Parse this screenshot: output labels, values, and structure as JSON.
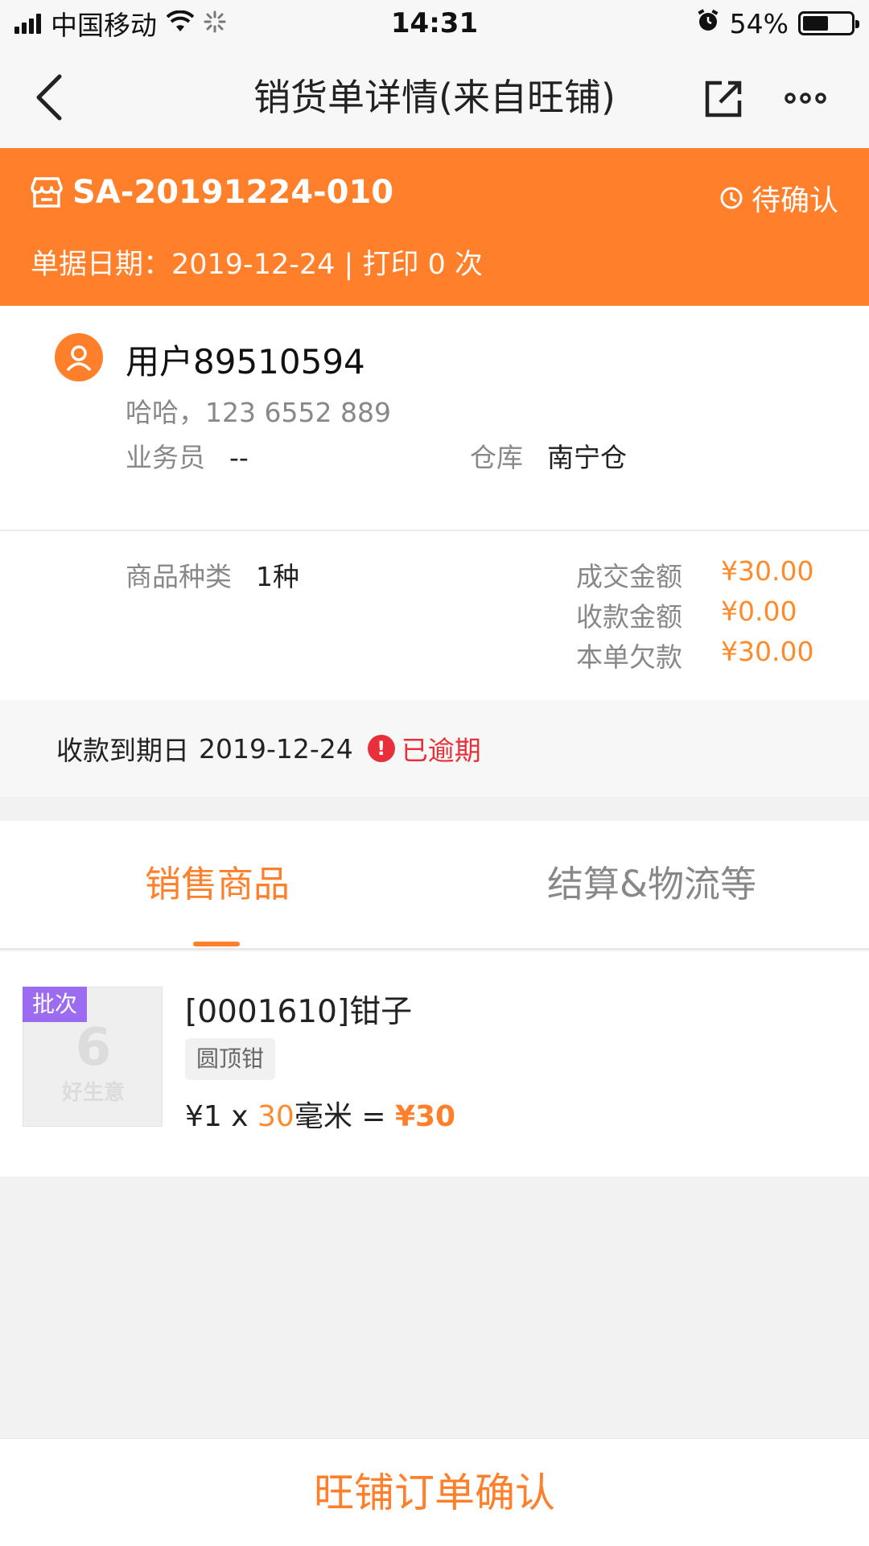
{
  "status_bar": {
    "carrier": "中国移动",
    "time": "14:31",
    "battery": "54%",
    "battery_level": 0.54
  },
  "nav": {
    "title": "销货单详情(来自旺铺)"
  },
  "order": {
    "number": "SA-20191224-010",
    "status": "待确认",
    "meta": "单据日期：2019-12-24 | 打印 0 次"
  },
  "customer": {
    "name": "用户89510594",
    "contact": "哈哈，123 6552 889",
    "salesperson_label": "业务员",
    "salesperson_value": "--",
    "warehouse_label": "仓库",
    "warehouse_value": "南宁仓"
  },
  "amounts": {
    "category_label": "商品种类",
    "category_value": "1种",
    "deal_label": "成交金额",
    "deal_value": "¥30.00",
    "received_label": "收款金额",
    "received_value": "¥0.00",
    "owed_label": "本单欠款",
    "owed_value": "¥30.00"
  },
  "due": {
    "label": "收款到期日",
    "date": "2019-12-24",
    "status": "已逾期"
  },
  "tabs": [
    {
      "label": "销售商品",
      "active": true
    },
    {
      "label": "结算&物流等",
      "active": false
    }
  ],
  "products": [
    {
      "badge": "批次",
      "thumb_text": "好生意",
      "name": "[0001610]钳子",
      "spec": "圆顶钳",
      "price": "¥1",
      "times": "x",
      "qty": "30",
      "unit": "毫米",
      "equals": "=",
      "total": "¥30"
    }
  ],
  "actions": {
    "confirm": "旺铺订单确认"
  },
  "colors": {
    "accent": "#ff7f2a",
    "danger": "#e8303a",
    "badge": "#9b6cf0"
  }
}
